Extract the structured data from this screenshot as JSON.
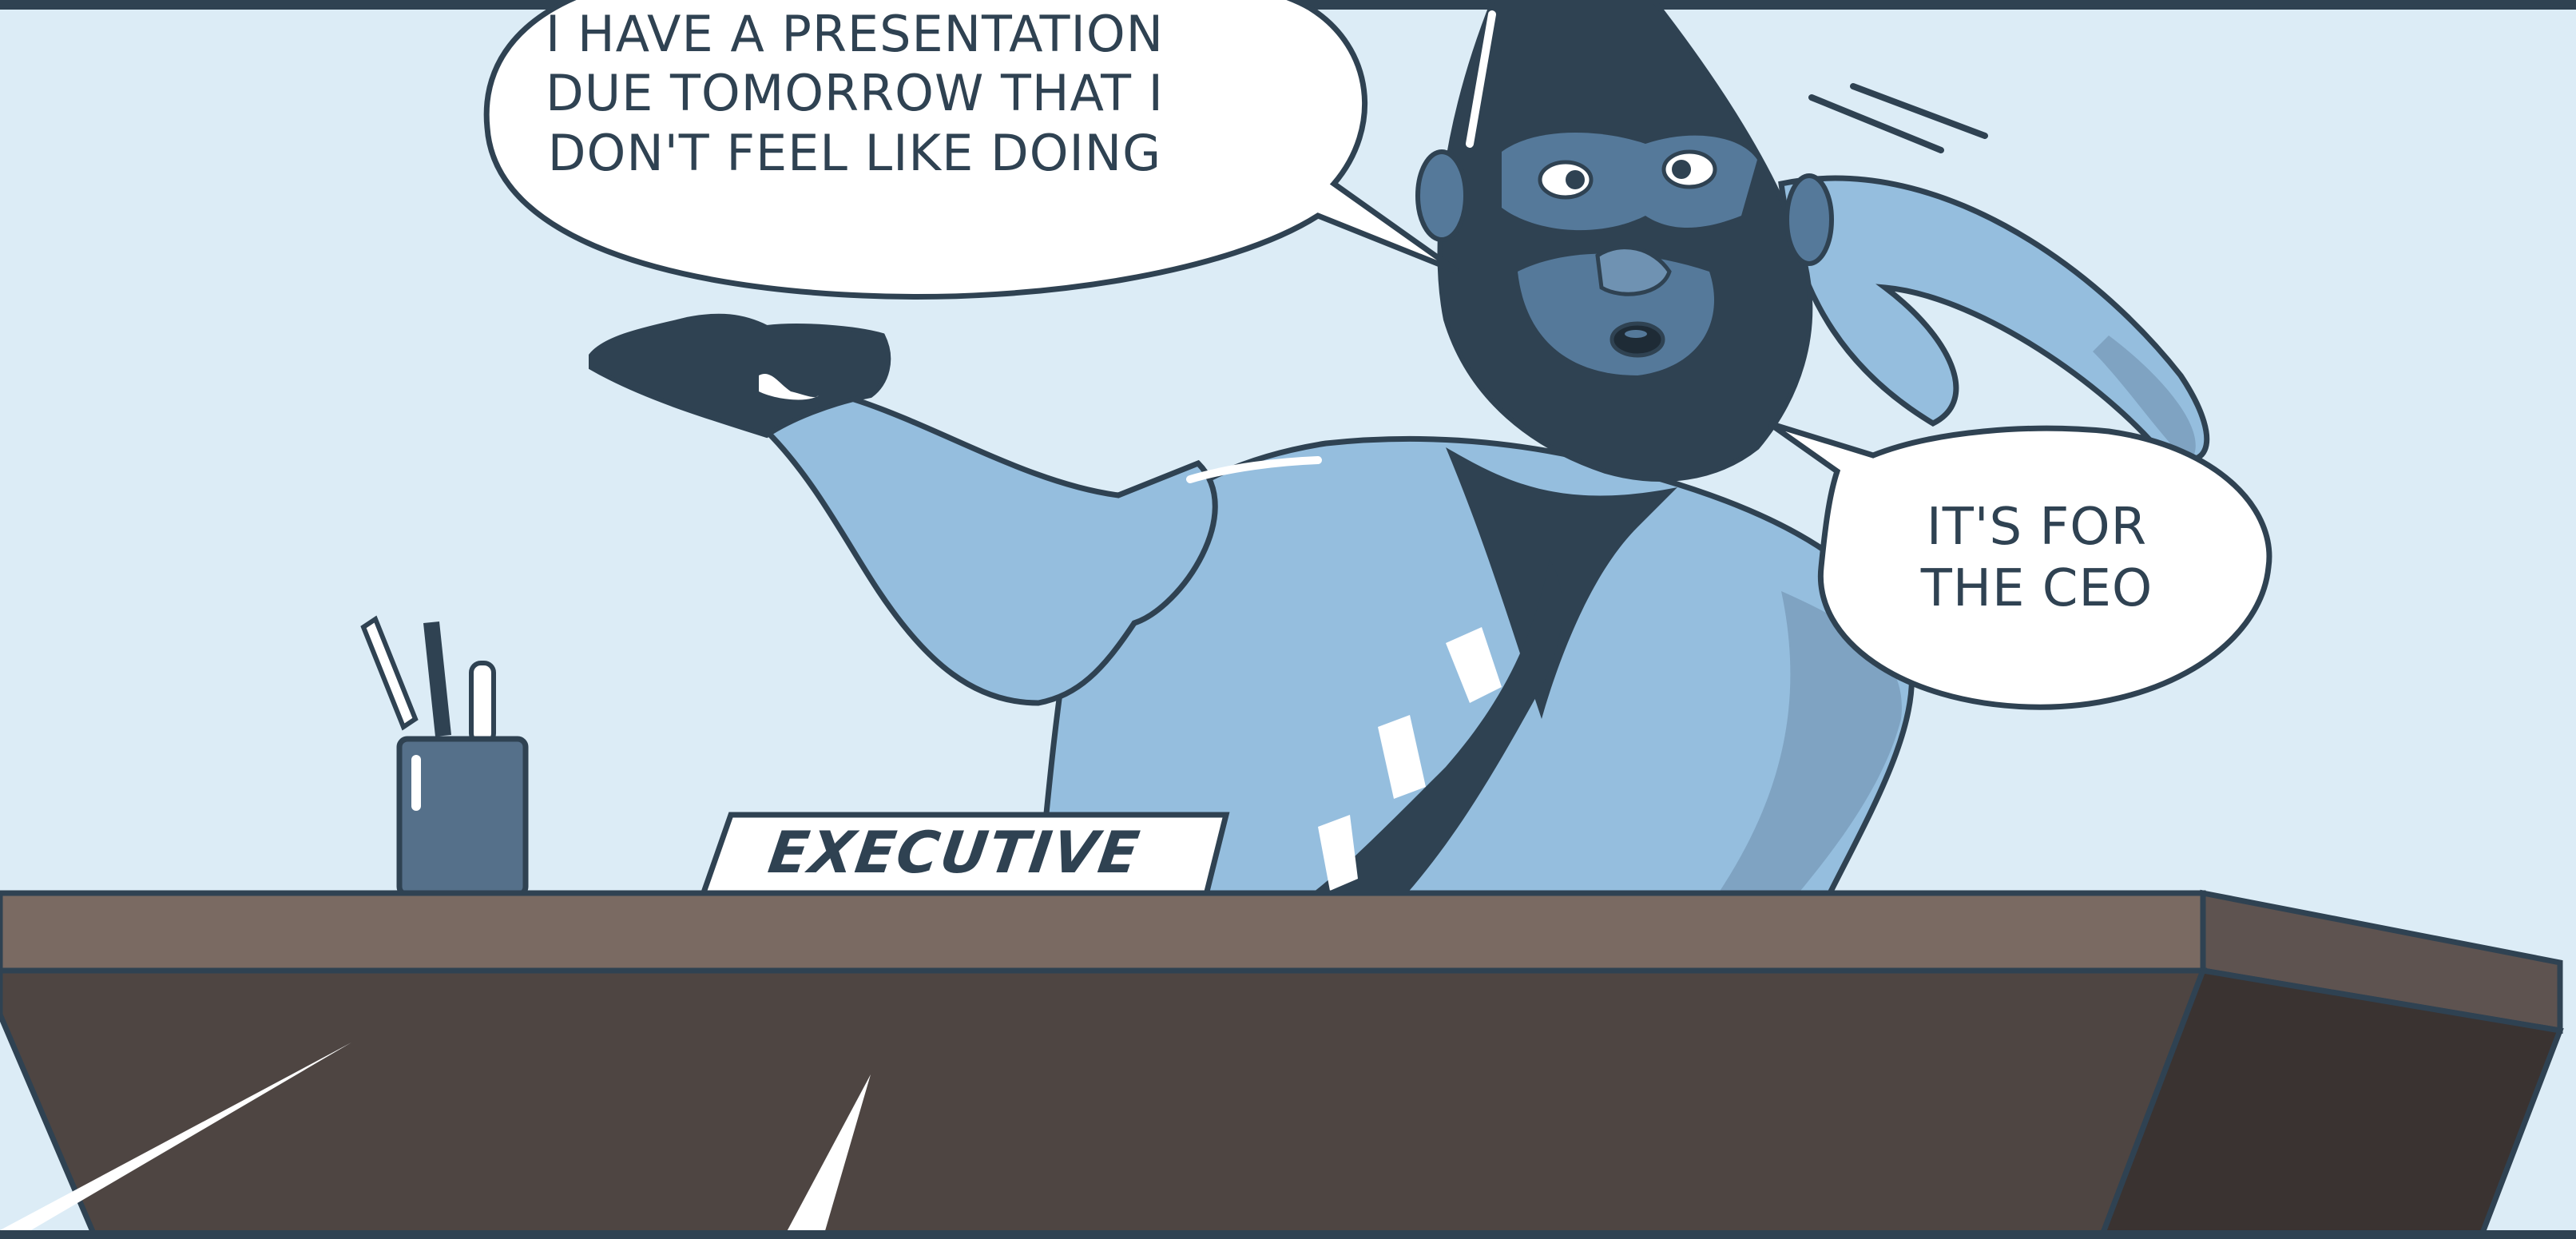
{
  "panel": {
    "speech_bubble_1": {
      "lines": [
        "I HAVE A PRESENTATION",
        "DUE TOMORROW THAT I",
        "DON'T FEEL LIKE DOING"
      ]
    },
    "speech_bubble_2": {
      "lines": [
        "IT'S FOR",
        "THE CEO"
      ]
    },
    "nameplate": "EXECUTIVE"
  },
  "colors": {
    "background": "#dcecf6",
    "outline": "#2f4252",
    "shirt": "#95bede",
    "shirt_shadow": "#7fa3c2",
    "head": "#2f4252",
    "face": "#55799a",
    "desk_top": "#7a6a62",
    "desk_front": "#4e4542",
    "desk_side": "#3a3331",
    "pen_cup": "#55708a",
    "white": "#ffffff"
  }
}
